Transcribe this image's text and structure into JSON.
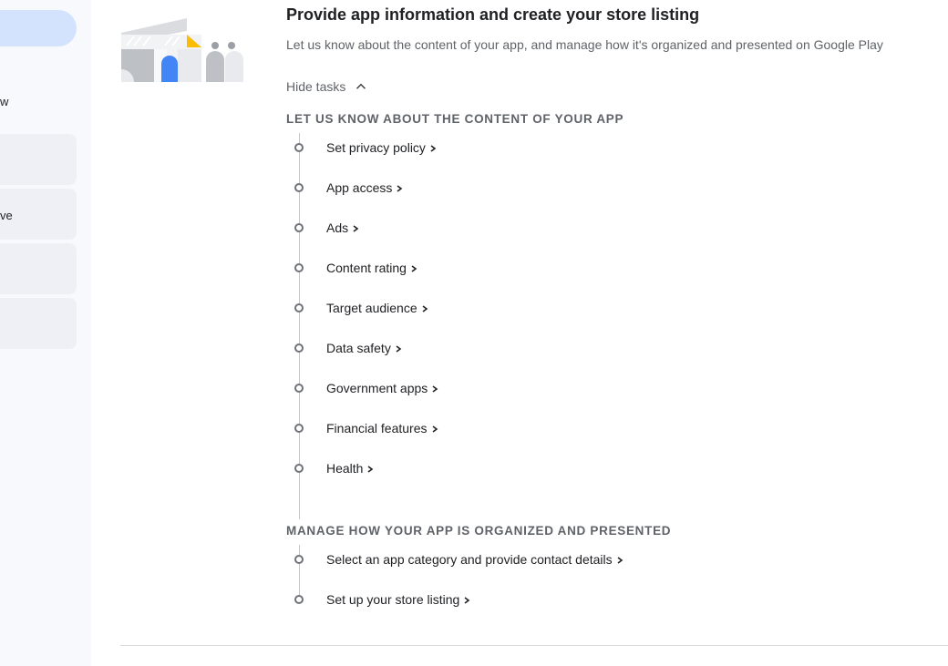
{
  "sidebar": {
    "fragment_1": "w",
    "fragment_2": "ve"
  },
  "header": {
    "title": "Provide app information and create your store listing",
    "subtitle": "Let us know about the content of your app, and manage how it's organized and presented on Google Play"
  },
  "hide_tasks": {
    "label": "Hide tasks",
    "icon": "chevron-up-icon"
  },
  "sections": [
    {
      "heading": "LET US KNOW ABOUT THE CONTENT OF YOUR APP",
      "tasks": [
        {
          "label": "Set privacy policy"
        },
        {
          "label": "App access"
        },
        {
          "label": "Ads"
        },
        {
          "label": "Content rating"
        },
        {
          "label": "Target audience"
        },
        {
          "label": "Data safety"
        },
        {
          "label": "Government apps"
        },
        {
          "label": "Financial features"
        },
        {
          "label": "Health"
        }
      ]
    },
    {
      "heading": "MANAGE HOW YOUR APP IS ORGANIZED AND PRESENTED",
      "tasks": [
        {
          "label": "Select an app category and provide contact details"
        },
        {
          "label": "Set up your store listing"
        }
      ]
    }
  ],
  "colors": {
    "accent_blue": "#4285f4",
    "accent_yellow": "#fbbc04",
    "sidebar_active": "#d3e3fd"
  }
}
